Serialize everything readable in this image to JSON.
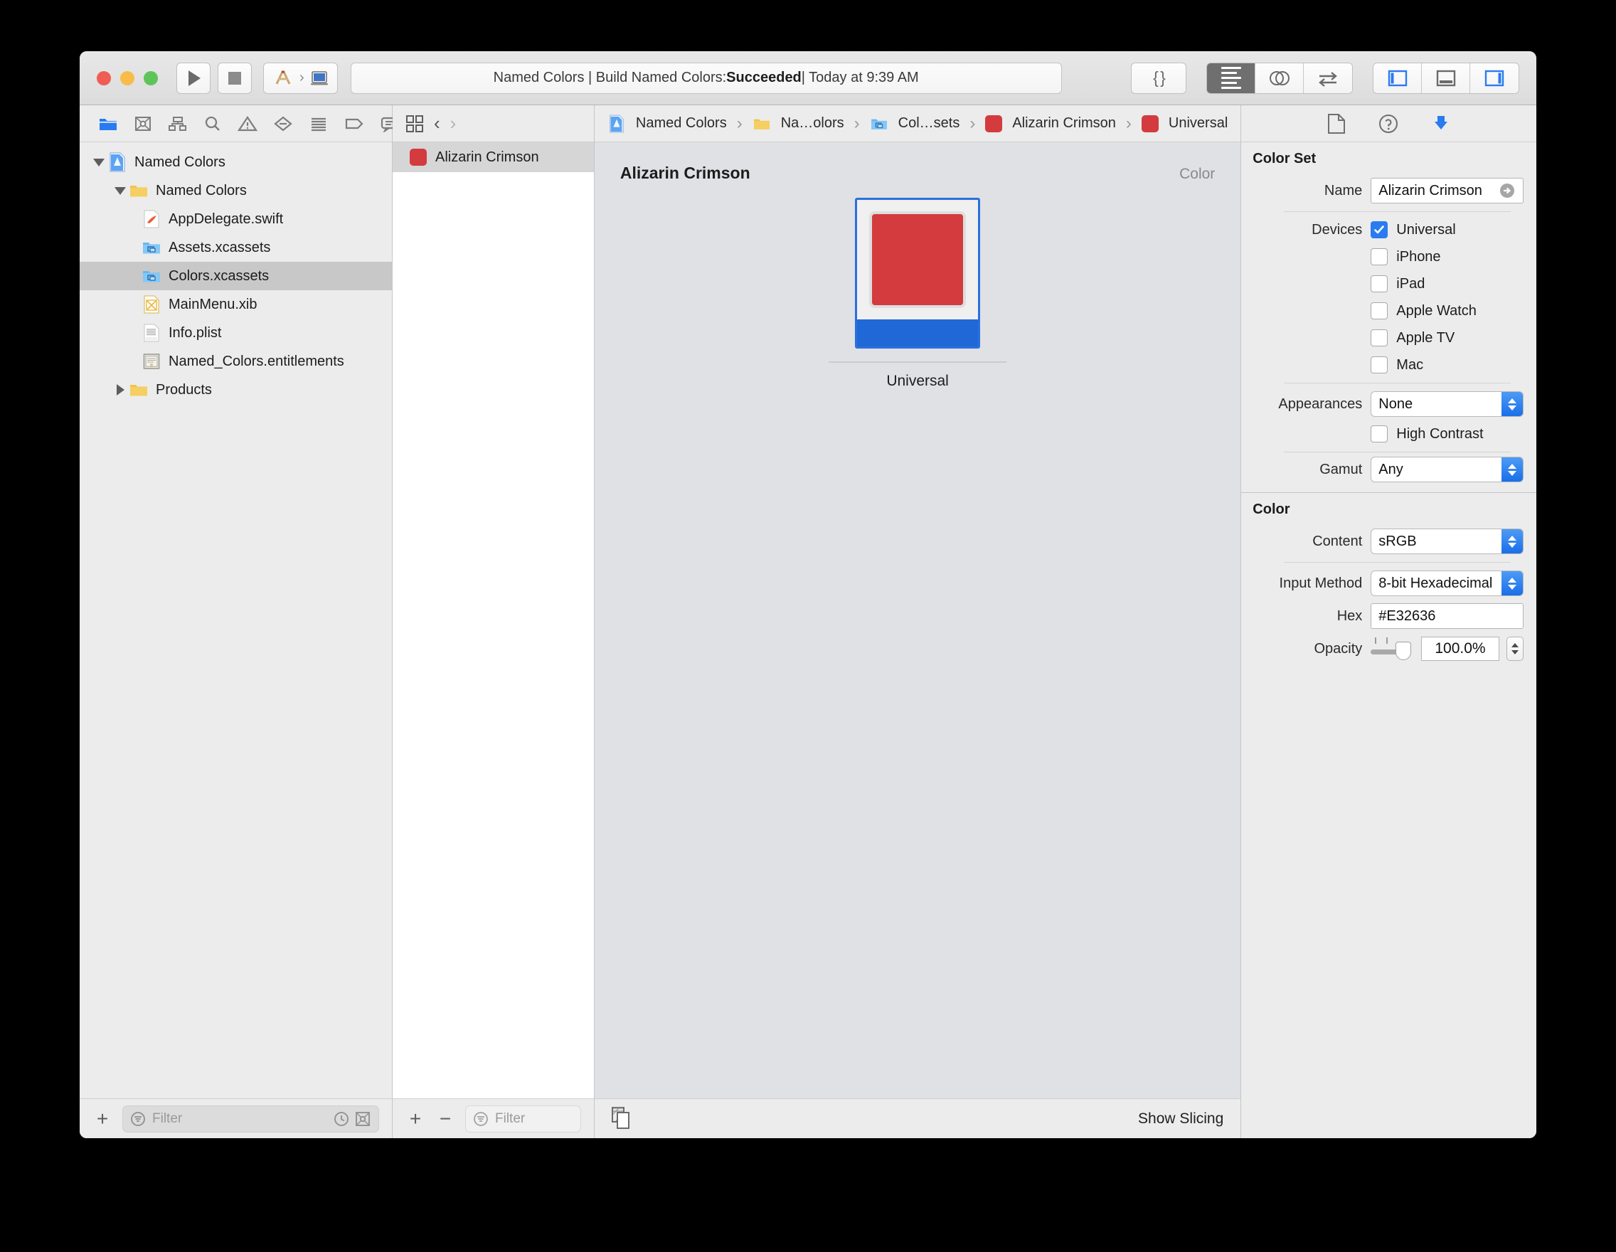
{
  "window": {
    "status": {
      "prefix": "Named Colors | Build Named Colors: ",
      "result": "Succeeded",
      "suffix": " | Today at 9:39 AM"
    },
    "scheme": {
      "project": "Named Colors",
      "destination": "My Mac"
    }
  },
  "toolbar": {
    "run_label": "Run",
    "stop_label": "Stop",
    "library_label": "Library",
    "editor_standard": "Standard Editor",
    "editor_assistant": "Assistant Editor",
    "editor_version": "Version Editor",
    "view_navigator": "Navigator",
    "view_debug": "Debug Area",
    "view_inspector": "Inspector"
  },
  "navigator": {
    "tabs": [
      "project-navigator-icon",
      "source-control-navigator-icon",
      "symbol-navigator-icon",
      "find-navigator-icon",
      "issue-navigator-icon",
      "test-navigator-icon",
      "debug-navigator-icon",
      "breakpoint-navigator-icon",
      "report-navigator-icon"
    ],
    "tree": [
      {
        "label": "Named Colors",
        "icon": "xcode-project-icon",
        "indent": 0,
        "disclosure": "open",
        "selected": false
      },
      {
        "label": "Named Colors",
        "icon": "folder-icon",
        "indent": 1,
        "disclosure": "open",
        "selected": false
      },
      {
        "label": "AppDelegate.swift",
        "icon": "swift-file-icon",
        "indent": 2,
        "disclosure": "none",
        "selected": false
      },
      {
        "label": "Assets.xcassets",
        "icon": "xcassets-icon",
        "indent": 2,
        "disclosure": "none",
        "selected": false
      },
      {
        "label": "Colors.xcassets",
        "icon": "xcassets-icon",
        "indent": 2,
        "disclosure": "none",
        "selected": true
      },
      {
        "label": "MainMenu.xib",
        "icon": "xib-file-icon",
        "indent": 2,
        "disclosure": "none",
        "selected": false
      },
      {
        "label": "Info.plist",
        "icon": "plist-file-icon",
        "indent": 2,
        "disclosure": "none",
        "selected": false
      },
      {
        "label": "Named_Colors.entitlements",
        "icon": "entitlements-file-icon",
        "indent": 2,
        "disclosure": "none",
        "selected": false
      },
      {
        "label": "Products",
        "icon": "folder-icon",
        "indent": 1,
        "disclosure": "closed",
        "selected": false
      }
    ],
    "footer": {
      "add_label": "+",
      "filter_placeholder": "Filter"
    }
  },
  "breadcrumb": {
    "items": [
      {
        "label": "Named Colors",
        "icon": "xcode-project-icon"
      },
      {
        "label": "Na…olors",
        "icon": "folder-icon"
      },
      {
        "label": "Col…sets",
        "icon": "xcassets-icon"
      },
      {
        "label": "Alizarin Crimson",
        "icon": "color-swatch-icon"
      },
      {
        "label": "Universal",
        "icon": "color-swatch-icon"
      }
    ],
    "separator": "›"
  },
  "asset_list": {
    "items": [
      {
        "label": "Alizarin Crimson",
        "selected": true
      }
    ],
    "footer": {
      "add_label": "+",
      "remove_label": "−",
      "filter_placeholder": "Filter"
    }
  },
  "editor": {
    "title": "Alizarin Crimson",
    "kind": "Color",
    "tile_label": "Universal",
    "show_slicing_label": "Show Slicing"
  },
  "inspector": {
    "tabs": [
      "file-inspector-icon",
      "quick-help-inspector-icon",
      "attributes-inspector-icon"
    ],
    "color_set": {
      "section_title": "Color Set",
      "name_label": "Name",
      "name_value": "Alizarin Crimson",
      "devices_label": "Devices",
      "devices": [
        {
          "label": "Universal",
          "checked": true
        },
        {
          "label": "iPhone",
          "checked": false
        },
        {
          "label": "iPad",
          "checked": false
        },
        {
          "label": "Apple Watch",
          "checked": false
        },
        {
          "label": "Apple TV",
          "checked": false
        },
        {
          "label": "Mac",
          "checked": false
        }
      ],
      "appearances_label": "Appearances",
      "appearances_value": "None",
      "high_contrast_label": "High Contrast",
      "high_contrast_checked": false,
      "gamut_label": "Gamut",
      "gamut_value": "Any"
    },
    "color": {
      "section_title": "Color",
      "content_label": "Content",
      "content_value": "sRGB",
      "input_method_label": "Input Method",
      "input_method_value": "8-bit Hexadecimal",
      "hex_label": "Hex",
      "hex_value": "#E32636",
      "opacity_label": "Opacity",
      "opacity_value": "100.0%"
    }
  },
  "colors": {
    "swatch_red": "#D33B3E",
    "tile_blue": "#1f68d6",
    "accent_blue": "#2a7bf0",
    "window_bg": "#ececec",
    "editor_bg": "#dfe1e5"
  }
}
